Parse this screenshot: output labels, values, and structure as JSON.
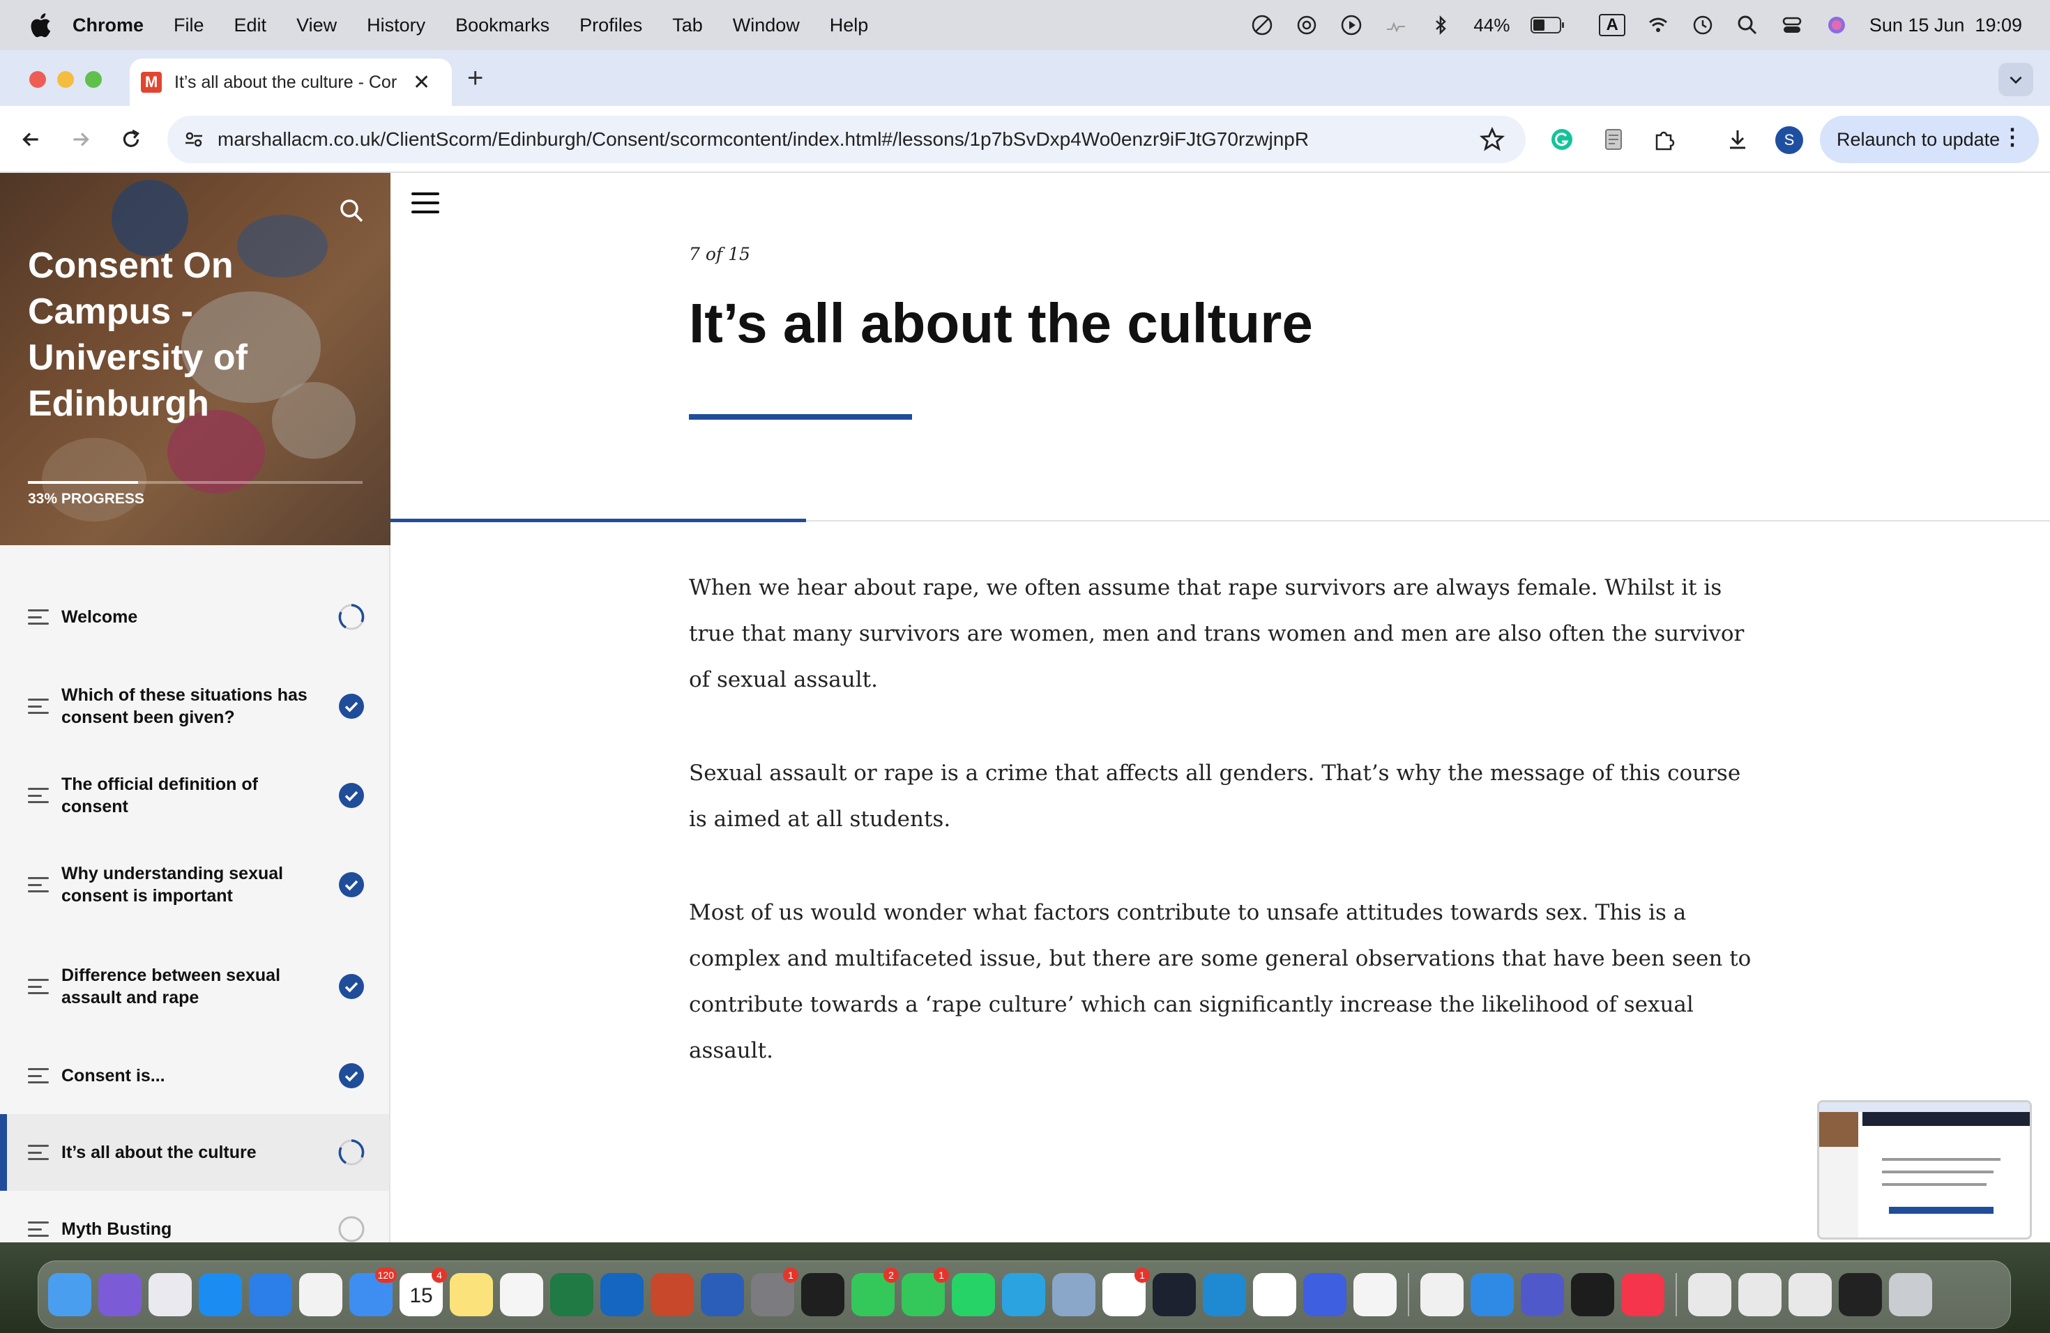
{
  "menubar": {
    "app": "Chrome",
    "items": [
      "File",
      "Edit",
      "View",
      "History",
      "Bookmarks",
      "Profiles",
      "Tab",
      "Window",
      "Help"
    ],
    "battery": "44%",
    "keyboard": "A",
    "datetime": "Sun 15 Jun  19:09"
  },
  "browser": {
    "tab_title": "It’s all about the culture - Cor",
    "tab_favicon": "M",
    "url": "marshallacm.co.uk/ClientScorm/Edinburgh/Consent/scormcontent/index.html#/lessons/1p7bSvDxp4Wo0enzr9iFJtG70rzwjnpR",
    "profile_initial": "S",
    "relaunch_label": "Relaunch to update"
  },
  "course": {
    "title": "Consent On Campus - University of Edinburgh",
    "progress_label": "33% PROGRESS",
    "progress": 0.33
  },
  "lessons": [
    {
      "label": "Welcome",
      "status": "in-progress"
    },
    {
      "label": "Which of these situations has consent been given?",
      "status": "complete"
    },
    {
      "label": "The official definition of consent",
      "status": "complete"
    },
    {
      "label": "Why understanding sexual consent is important",
      "status": "complete"
    },
    {
      "label": "Difference between sexual assault and rape",
      "status": "complete"
    },
    {
      "label": "Consent is...",
      "status": "complete"
    },
    {
      "label": "It’s all about the culture",
      "status": "in-progress",
      "active": true
    },
    {
      "label": "Myth Busting",
      "status": "not-started"
    }
  ],
  "lesson_content": {
    "counter": "7 of 15",
    "heading": "It’s all about the culture",
    "paragraphs": [
      "When we hear about rape, we often assume that rape survivors are always female. Whilst it is true that many survivors are women, men and trans women and men are also often the survivor of sexual assault.",
      "Sexual assault or rape is a crime that affects all genders. That’s why the message of this course is aimed at all students.",
      "Most of us would wonder what factors contribute to unsafe attitudes towards sex.  This is a complex and multifaceted issue, but there are some general observations that have been seen to contribute towards a ‘rape culture’ which can significantly increase the likelihood of sexual assault."
    ]
  },
  "colors": {
    "accent": "#1f4d9a",
    "complete": "#1f4d9a"
  },
  "dock": {
    "apps": [
      {
        "name": "finder-icon",
        "color": "#4a9ef0"
      },
      {
        "name": "siri-icon",
        "color": "#7b5cd6"
      },
      {
        "name": "launchpad-icon",
        "color": "#e9e9ef"
      },
      {
        "name": "app-store-icon",
        "color": "#1b8df2"
      },
      {
        "name": "safari-icon",
        "color": "#2c7ee8"
      },
      {
        "name": "chrome-icon",
        "color": "#f2f2f2"
      },
      {
        "name": "mail-icon",
        "color": "#3d8ef0",
        "badge": "120"
      },
      {
        "name": "calendar-icon",
        "color": "#ffffff",
        "badge": "4",
        "text": "15"
      },
      {
        "name": "notes-icon",
        "color": "#fbe27a"
      },
      {
        "name": "photos-icon",
        "color": "#f5f5f5"
      },
      {
        "name": "excel-icon",
        "color": "#1f7a44"
      },
      {
        "name": "outlook-icon",
        "color": "#1466c0"
      },
      {
        "name": "powerpoint-icon",
        "color": "#c8482b"
      },
      {
        "name": "word-icon",
        "color": "#2b5eb8"
      },
      {
        "name": "system-settings-icon",
        "color": "#7b7b80",
        "badge": "1"
      },
      {
        "name": "spotify-icon",
        "color": "#1f1f1f"
      },
      {
        "name": "messages-icon",
        "color": "#34c759",
        "badge": "2"
      },
      {
        "name": "facetime-icon",
        "color": "#34c759",
        "badge": "1"
      },
      {
        "name": "whatsapp-icon",
        "color": "#25d366"
      },
      {
        "name": "telegram-icon",
        "color": "#2aa3e0"
      },
      {
        "name": "preview-icon",
        "color": "#8aa6c8"
      },
      {
        "name": "slack-icon",
        "color": "#ffffff",
        "badge": "1"
      },
      {
        "name": "cursor-icon",
        "color": "#1c2230"
      },
      {
        "name": "vscode-icon",
        "color": "#1f8ad2"
      },
      {
        "name": "notion-icon",
        "color": "#ffffff"
      },
      {
        "name": "nordvpn-icon",
        "color": "#3e5fe0"
      },
      {
        "name": "zotero-icon",
        "color": "#f4f4f4"
      },
      {
        "name": "chatgpt-icon",
        "color": "#f0f0f0"
      },
      {
        "name": "keynote-icon",
        "color": "#2f8ae6"
      },
      {
        "name": "teams-icon",
        "color": "#5059c9"
      },
      {
        "name": "activity-monitor-icon",
        "color": "#1d1d1d"
      },
      {
        "name": "music-icon",
        "color": "#f4354c"
      },
      {
        "name": "window-thumb-1-icon",
        "color": "#e8e8e8"
      },
      {
        "name": "window-thumb-2-icon",
        "color": "#e8e8e8"
      },
      {
        "name": "window-thumb-3-icon",
        "color": "#e8e8e8"
      },
      {
        "name": "window-thumb-4-icon",
        "color": "#222222"
      },
      {
        "name": "trash-icon",
        "color": "#c9ccd0"
      }
    ]
  }
}
